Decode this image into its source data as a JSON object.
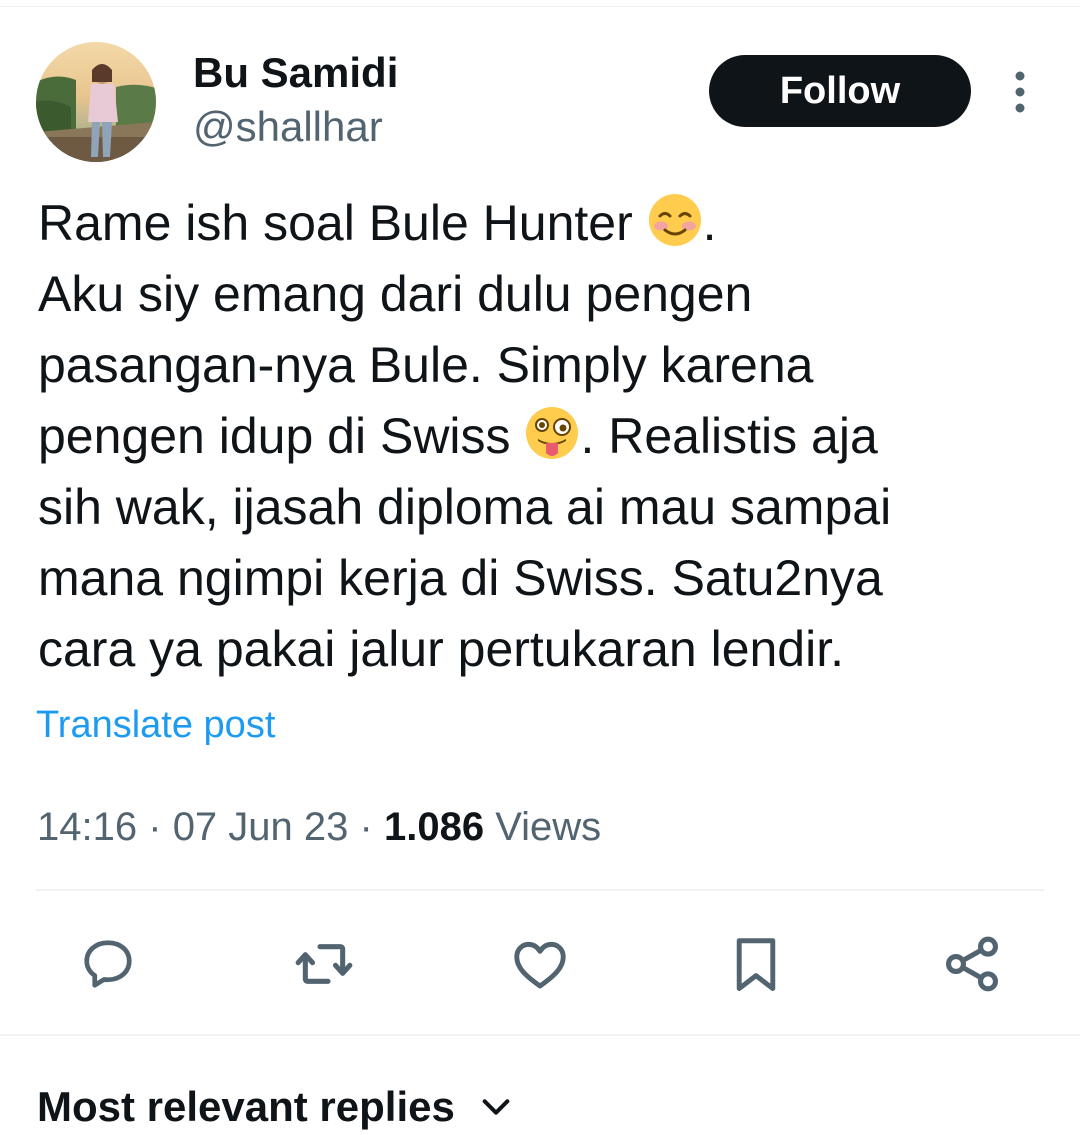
{
  "author": {
    "name": "Bu Samidi",
    "handle": "@shallhar"
  },
  "follow_button": "Follow",
  "tweet": {
    "line1": "Rame ish soal Bule Hunter ",
    "line1_end": ".",
    "line2": "Aku siy emang dari dulu pengen",
    "line3": "pasangan-nya Bule. Simply karena",
    "line4": "pengen idup di Swiss ",
    "line4_end": ". Realistis aja",
    "line5": "sih wak, ijasah diploma ai mau sampai",
    "line6": "mana ngimpi kerja di Swiss. Satu2nya",
    "line7": "cara ya pakai jalur pertukaran lendir."
  },
  "translate_link": "Translate post",
  "meta": {
    "time": "14:16",
    "separator": "·",
    "date": "07 Jun 23",
    "views_count": "1.086",
    "views_label": "Views"
  },
  "actions": {
    "reply_icon": "reply-icon",
    "repost_icon": "repost-icon",
    "like_icon": "heart-icon",
    "bookmark_icon": "bookmark-icon",
    "share_icon": "share-icon"
  },
  "replies_sort": {
    "label": "Most relevant replies"
  },
  "colors": {
    "text": "#0f1419",
    "secondary": "#536471",
    "link": "#1d9bf0",
    "divider": "#eff3f4"
  }
}
